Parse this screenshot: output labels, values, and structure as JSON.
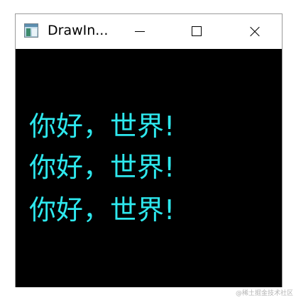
{
  "window": {
    "title": "DrawIn...",
    "app_icon": "app-window-icon",
    "controls": {
      "minimize_icon": "minimize-icon",
      "maximize_icon": "maximize-icon",
      "close_icon": "close-icon"
    }
  },
  "client": {
    "background": "#000000",
    "text_color": "#2ee8ee",
    "lines": [
      "你好，世界!",
      "你好，世界!",
      "你好，世界!"
    ]
  },
  "watermark": "@稀土掘金技术社区"
}
